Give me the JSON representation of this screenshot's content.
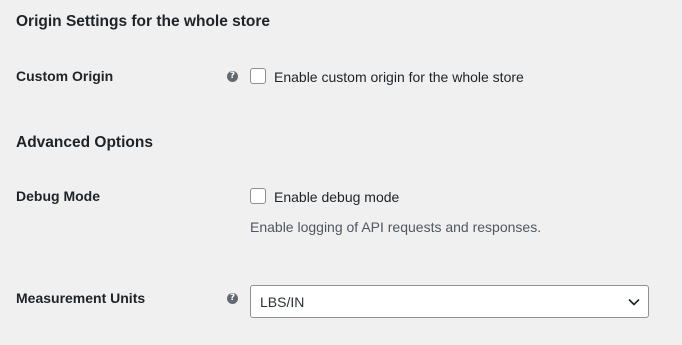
{
  "sections": {
    "origin": {
      "heading": "Origin Settings for the whole store",
      "custom_origin": {
        "label": "Custom Origin",
        "help_icon": "question-circle-icon",
        "help_glyph": "?",
        "checkbox_label": "Enable custom origin for the whole store",
        "checked": false
      }
    },
    "advanced": {
      "heading": "Advanced Options",
      "debug_mode": {
        "label": "Debug Mode",
        "checkbox_label": "Enable debug mode",
        "checked": false,
        "description": "Enable logging of API requests and responses."
      },
      "measurement_units": {
        "label": "Measurement Units",
        "help_icon": "question-circle-icon",
        "help_glyph": "?",
        "selected_value": "LBS/IN",
        "dropdown_icon": "chevron-down-icon"
      }
    }
  },
  "colors": {
    "background": "#f0f0f1",
    "text": "#1d2327",
    "description_text": "#50575e",
    "input_border": "#8c8f94",
    "help_icon_bg": "#646970"
  }
}
